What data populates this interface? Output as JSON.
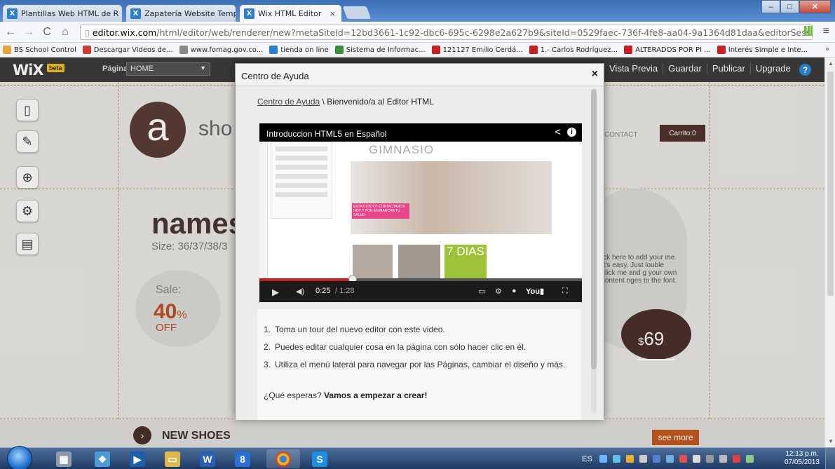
{
  "browser": {
    "tabs": [
      {
        "title": "Plantillas Web HTML de R"
      },
      {
        "title": "Zapatería Website Templa"
      },
      {
        "title": "Wix HTML Editor"
      }
    ],
    "url_host": "editor.wix.com",
    "url_rest": "/html/editor/web/renderer/new?metaSiteId=12bd3661-1c92-dbc6-695c-6298e2a627b9&siteId=0529faec-736f-4fe8-aa04-9a1364d81daa&editorSessionId",
    "bookmarks": [
      {
        "label": "BS School Control",
        "color": "#e6a23c"
      },
      {
        "label": "Descargar Videos de...",
        "color": "#d13b2f"
      },
      {
        "label": "www.fomag.gov.co...",
        "color": "#888888"
      },
      {
        "label": "tienda on line",
        "color": "#2a7fd4"
      },
      {
        "label": "Sistema de Informac...",
        "color": "#3a8f3a"
      },
      {
        "label": "121127 Emilio Cerdá...",
        "color": "#cc1f1f"
      },
      {
        "label": "1.- Carlos Rodríguez...",
        "color": "#cc1f1f"
      },
      {
        "label": "ALTERADOS POR PI ...",
        "color": "#cc1f1f"
      },
      {
        "label": "Interés Simple e Inte...",
        "color": "#cc1f1f"
      }
    ],
    "bookmarks_more": "»"
  },
  "wix": {
    "logo": "WiX",
    "beta": "beta",
    "page_label": "Página",
    "page_value": "HOME",
    "menu": [
      "Vista Previa",
      "Guardar",
      "Publicar",
      "Upgrade"
    ],
    "help": "?"
  },
  "site": {
    "logo_letter": "a",
    "shop_text": "sho",
    "name_text": "names",
    "size_text": "Size: 36/37/38/3",
    "sale_label": "Sale:",
    "sale_pct": "40",
    "sale_pct_sign": "%",
    "sale_off": "OFF",
    "contact": "CONTACT",
    "carrito": "Carrito:0",
    "add_text": "ick here to add your me. It's easy. Just louble click me and g your own content nges to the font.",
    "price_sign": "$",
    "price": "69",
    "new_shoes": "NEW SHOES",
    "see_more": "see more"
  },
  "dialog": {
    "title": "Centro de Ayuda",
    "close": "×",
    "crumb_link": "Centro de Ayuda",
    "crumb_rest": " \\ Bienvenido/a al Editor HTML",
    "video": {
      "title": "Introduccion HTML5 en Español",
      "time_current": "0:25",
      "time_total": "/ 1:28",
      "brand": "GIMNASIO",
      "banner": "ESTAS LISTO? CONTACTANOS HOY Y PON EN MARCHA TU SALUD",
      "promo": "7 DIAS",
      "progress": 0.29
    },
    "steps": [
      {
        "n": "1.",
        "text": "Toma un tour del nuevo editor con este video."
      },
      {
        "n": "2.",
        "text": "Puedes editar cualquier cosa en la página con sólo hacer clic en él."
      },
      {
        "n": "3.",
        "text": "Utiliza el menú lateral para navegar por las Páginas, cambiar el diseño y más."
      }
    ],
    "cta_lead": "¿Qué esperas? ",
    "cta_bold": "Vamos a empezar a crear!"
  },
  "taskbar": {
    "lang": "ES",
    "time": "12:13 p.m.",
    "date": "07/05/2013"
  }
}
